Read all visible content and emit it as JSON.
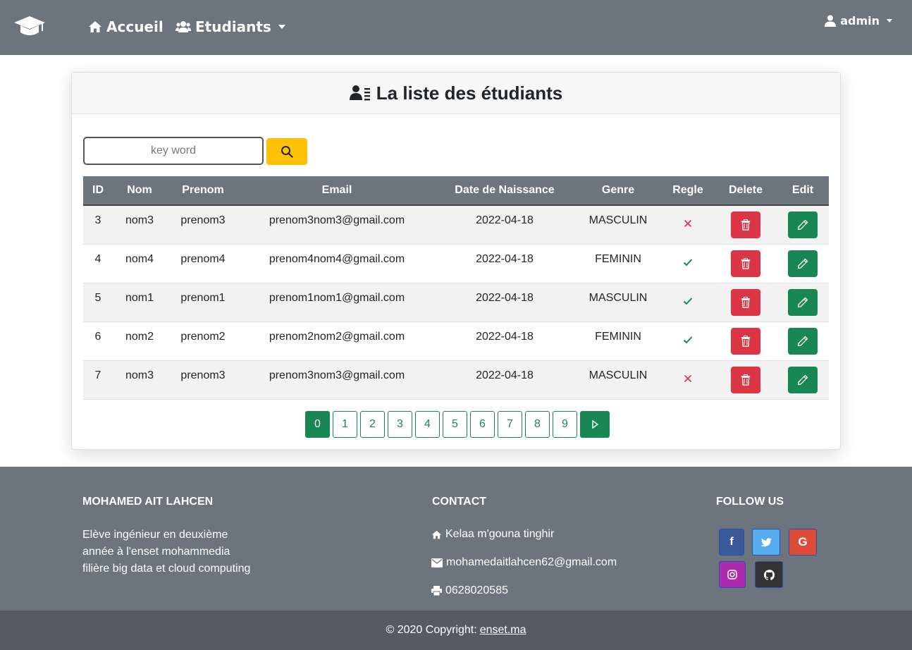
{
  "navbar": {
    "home_label": "Accueil",
    "students_label": "Etudiants",
    "user_label": "admin"
  },
  "card": {
    "title": "La liste des étudiants"
  },
  "search": {
    "placeholder": "key word",
    "value": ""
  },
  "table": {
    "headers": [
      "ID",
      "Nom",
      "Prenom",
      "Email",
      "Date de Naissance",
      "Genre",
      "Regle",
      "Delete",
      "Edit"
    ],
    "rows": [
      {
        "id": "3",
        "nom": "nom3",
        "prenom": "prenom3",
        "email": "prenom3nom3@gmail.com",
        "date": "2022-04-18",
        "genre": "MASCULIN",
        "regle": false
      },
      {
        "id": "4",
        "nom": "nom4",
        "prenom": "prenom4",
        "email": "prenom4nom4@gmail.com",
        "date": "2022-04-18",
        "genre": "FEMININ",
        "regle": true
      },
      {
        "id": "5",
        "nom": "nom1",
        "prenom": "prenom1",
        "email": "prenom1nom1@gmail.com",
        "date": "2022-04-18",
        "genre": "MASCULIN",
        "regle": true
      },
      {
        "id": "6",
        "nom": "nom2",
        "prenom": "prenom2",
        "email": "prenom2nom2@gmail.com",
        "date": "2022-04-18",
        "genre": "FEMININ",
        "regle": true
      },
      {
        "id": "7",
        "nom": "nom3",
        "prenom": "prenom3",
        "email": "prenom3nom3@gmail.com",
        "date": "2022-04-18",
        "genre": "MASCULIN",
        "regle": false
      }
    ]
  },
  "pagination": {
    "pages": [
      "0",
      "1",
      "2",
      "3",
      "4",
      "5",
      "6",
      "7",
      "8",
      "9"
    ],
    "active": "0"
  },
  "footer": {
    "about_title": "MOHAMED AIT LAHCEN",
    "about_lines": [
      "Elève ingénieur en deuxième",
      "année à l'enset mohammedia",
      "filière big data et cloud computing"
    ],
    "contact_title": "CONTACT",
    "address": "Kelaa m'gouna tinghir",
    "email": "mohamedaitlahcen62@gmail.com",
    "phone": "0628020585",
    "follow_title": "FOLLOW US"
  },
  "copyright": {
    "text": "© 2020 Copyright:",
    "link": "enset.ma"
  },
  "colors": {
    "navbar": "#6c757d",
    "warning": "#ffc107",
    "danger": "#dc3545",
    "success": "#198754",
    "facebook": "#3b5998",
    "twitter": "#55acee",
    "google": "#dd4b39",
    "instagram": "#ac2bac",
    "github": "#333333"
  }
}
